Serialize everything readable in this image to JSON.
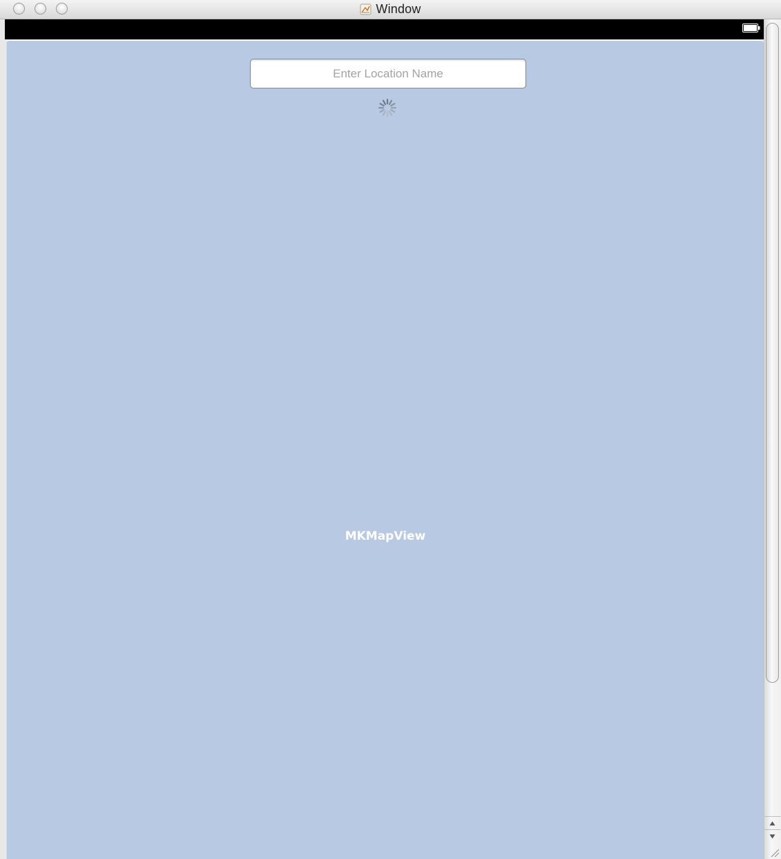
{
  "window": {
    "title": "Window",
    "title_icon": "interface-builder-document-icon"
  },
  "traffic_lights": [
    {
      "name": "close-button"
    },
    {
      "name": "minimize-button"
    },
    {
      "name": "zoom-button"
    }
  ],
  "status_bar": {
    "battery_icon": "battery-icon"
  },
  "map_view": {
    "label": "MKMapView",
    "background_color": "#b8c9e3"
  },
  "location_field": {
    "placeholder": "Enter Location Name",
    "value": ""
  },
  "activity_indicator": {
    "icon": "spinner-icon"
  },
  "scrollbar": {
    "up_arrow": "scroll-up-arrow-icon",
    "down_arrow": "scroll-down-arrow-icon"
  }
}
